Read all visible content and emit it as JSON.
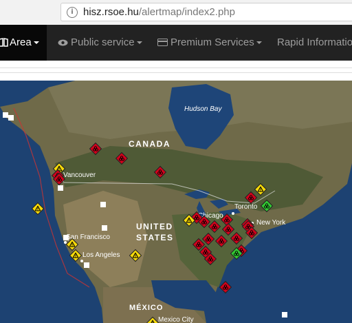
{
  "browser": {
    "url_host": "hisz.rsoe.hu",
    "url_path": "/alertmap/index2.php"
  },
  "nav": {
    "items": [
      {
        "label": "Area",
        "icon": "book-icon"
      },
      {
        "label": "Public service",
        "icon": "eye-icon"
      },
      {
        "label": "Premium Services",
        "icon": "card-icon"
      },
      {
        "label": "Rapid Information"
      }
    ]
  },
  "map": {
    "labels": {
      "hudson_bay": "Hudson Bay",
      "canada": "CANADA",
      "united": "UNITED",
      "states": "STATES",
      "mexico": "MÉXICO",
      "vancouver": "Vancouver",
      "chicago": "Chicago",
      "toronto": "Toronto",
      "new_york": "New York",
      "san_francisco": "San Francisco",
      "los_angeles": "Los Angeles",
      "mexico_city": "Mexico City"
    },
    "colors": {
      "alert_red": "#d0021b",
      "alert_yellow": "#f5d90a",
      "alert_green": "#32c832"
    },
    "markers": [
      {
        "level": "red",
        "icon": "biohazard-icon"
      },
      {
        "level": "red",
        "icon": "biohazard-icon"
      },
      {
        "level": "red",
        "icon": "biohazard-icon"
      },
      {
        "level": "yellow",
        "icon": "hazard-icon"
      },
      {
        "level": "red",
        "icon": "biohazard-icon"
      },
      {
        "level": "red",
        "icon": "biohazard-icon"
      },
      {
        "level": "yellow",
        "icon": "hazard-icon"
      },
      {
        "level": "yellow",
        "icon": "hazard-icon"
      },
      {
        "level": "yellow",
        "icon": "hazard-icon"
      },
      {
        "level": "yellow",
        "icon": "hazard-icon"
      },
      {
        "level": "red",
        "icon": "biohazard-icon"
      },
      {
        "level": "red",
        "icon": "biohazard-icon"
      },
      {
        "level": "red",
        "icon": "biohazard-icon"
      },
      {
        "level": "red",
        "icon": "biohazard-icon"
      },
      {
        "level": "red",
        "icon": "biohazard-icon"
      },
      {
        "level": "red",
        "icon": "biohazard-icon"
      },
      {
        "level": "red",
        "icon": "biohazard-icon"
      },
      {
        "level": "red",
        "icon": "biohazard-icon"
      },
      {
        "level": "red",
        "icon": "biohazard-icon"
      },
      {
        "level": "red",
        "icon": "biohazard-icon"
      },
      {
        "level": "red",
        "icon": "biohazard-icon"
      },
      {
        "level": "red",
        "icon": "biohazard-icon"
      },
      {
        "level": "yellow",
        "icon": "hazard-icon"
      },
      {
        "level": "red",
        "icon": "biohazard-icon"
      },
      {
        "level": "red",
        "icon": "biohazard-icon"
      },
      {
        "level": "red",
        "icon": "biohazard-icon"
      },
      {
        "level": "red",
        "icon": "biohazard-icon"
      },
      {
        "level": "green",
        "icon": "biohazard-icon"
      },
      {
        "level": "green",
        "icon": "biohazard-icon"
      },
      {
        "level": "yellow",
        "icon": "hazard-icon"
      },
      {
        "level": "red",
        "icon": "biohazard-icon"
      },
      {
        "level": "yellow",
        "icon": "hazard-icon"
      }
    ]
  }
}
